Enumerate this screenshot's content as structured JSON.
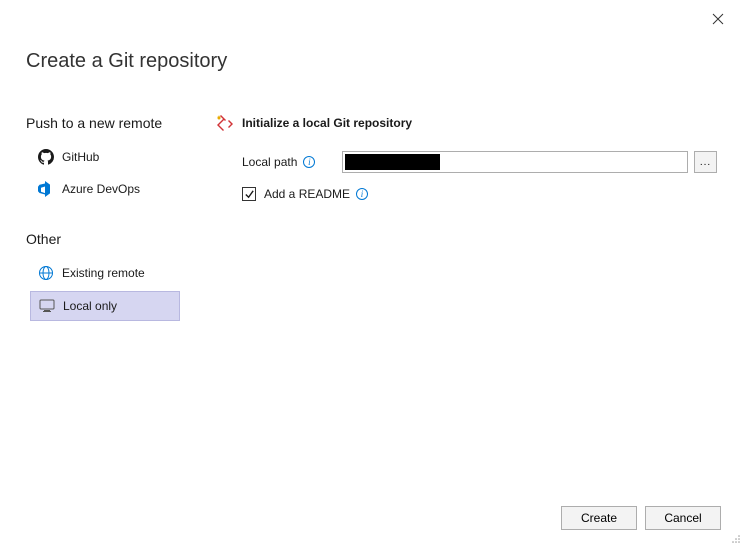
{
  "window": {
    "title": "Create a Git repository"
  },
  "sidebar": {
    "push_header": "Push to a new remote",
    "other_header": "Other",
    "items": {
      "github": {
        "label": "GitHub"
      },
      "azure": {
        "label": "Azure DevOps"
      },
      "existing": {
        "label": "Existing remote"
      },
      "local": {
        "label": "Local only"
      }
    },
    "selected": "local"
  },
  "main": {
    "heading": "Initialize a local Git repository",
    "local_path_label": "Local path",
    "local_path_value": "",
    "browse_label": "...",
    "readme_checked": true,
    "readme_label": "Add a README"
  },
  "footer": {
    "create": "Create",
    "cancel": "Cancel"
  }
}
